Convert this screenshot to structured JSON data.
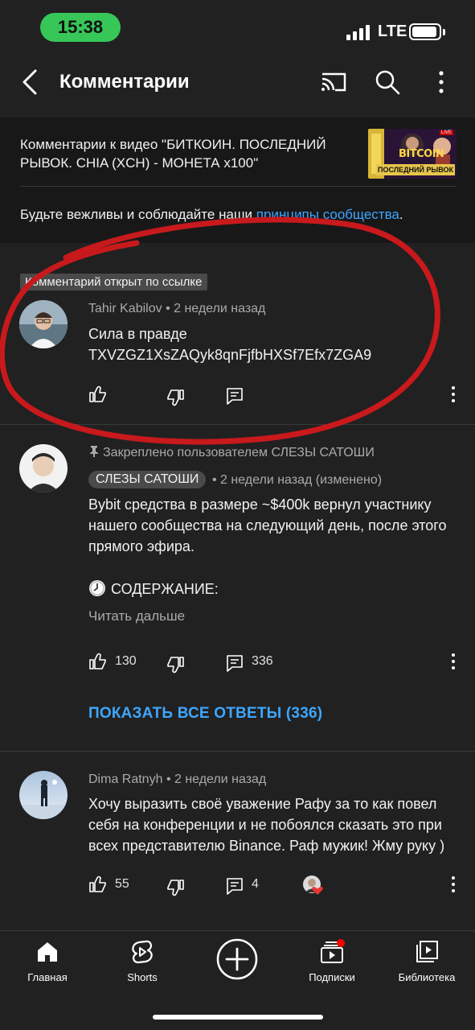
{
  "status_bar": {
    "time": "15:38",
    "network": "LTE"
  },
  "header": {
    "title": "Комментарии"
  },
  "video": {
    "caption": "Комментарии к видео \"БИТКОИН. ПОСЛЕДНИЙ РЫВОК. CHIA (XCH) - МОНЕТА x100\"",
    "thumbnail": {
      "title": "BITCOIN",
      "subtitle": "ПОСЛЕДНИЙ РЫВОК",
      "badge": "LIVE"
    },
    "community_prefix": "Будьте вежливы и соблюдайте наши ",
    "community_link": "принципы сообщества",
    "community_suffix": "."
  },
  "comments": [
    {
      "badge": "Комментарий открыт по ссылке",
      "author": "Tahir Kabilov",
      "time": "2 недели назад",
      "text_line1": "Сила в правде",
      "text_line2": "TXVZGZ1XsZAQyk8qnFjfbHXSf7Efx7ZGA9"
    },
    {
      "pinned": "Закреплено пользователем СЛЕЗЫ САТОШИ",
      "author": "СЛЕЗЫ САТОШИ",
      "time": "2 недели назад (изменено)",
      "text_line1": "Bybit средства в размере ~$400k вернул участнику",
      "text_line2": "нашего сообщества на следующий день, после этого",
      "text_line3": "прямого эфира.",
      "contents": "СОДЕРЖАНИЕ:",
      "read_more": "Читать дальше",
      "likes": "130",
      "replies": "336",
      "show_replies": "ПОКАЗАТЬ ВСЕ ОТВЕТЫ (336)"
    },
    {
      "author": "Dima Ratnyh",
      "time": "2 недели назад",
      "text_line1": "Хочу выразить своё уважение Рафу за то как повел",
      "text_line2": "себя на конференции и не побоялся сказать это при",
      "text_line3": "всех представителю Binance. Раф мужик!  Жму руку )",
      "likes": "55",
      "replies": "4"
    }
  ],
  "bottom_nav": [
    {
      "label": "Главная",
      "icon": "home-icon"
    },
    {
      "label": "Shorts",
      "icon": "shorts-icon"
    },
    {
      "label": "",
      "icon": "create-icon"
    },
    {
      "label": "Подписки",
      "icon": "subscriptions-icon"
    },
    {
      "label": "Библиотека",
      "icon": "library-icon"
    }
  ],
  "colors": {
    "background": "#212121",
    "link": "#3ea6ff",
    "status_pill": "#37c759",
    "annotation": "#c8191c"
  }
}
